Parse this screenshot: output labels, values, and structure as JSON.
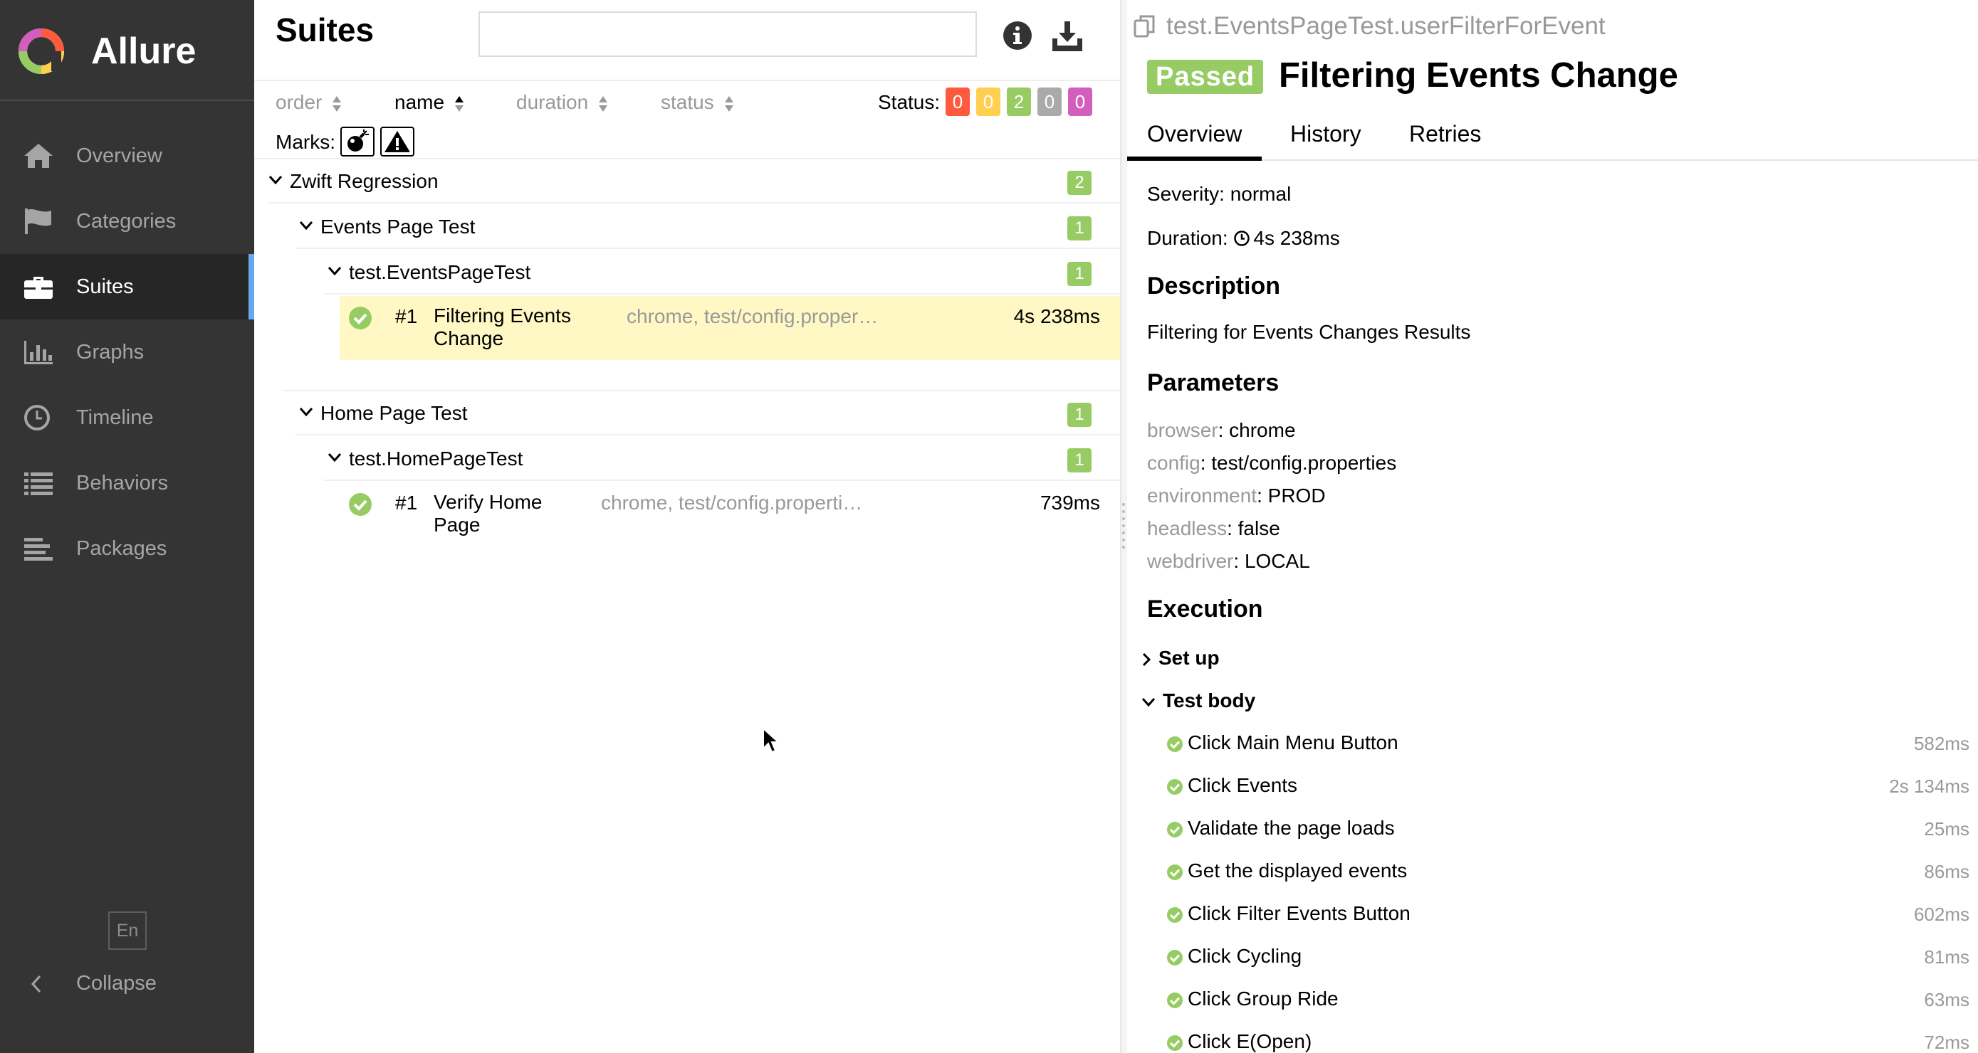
{
  "sidebar": {
    "brand": "Allure",
    "items": [
      {
        "label": "Overview",
        "icon": "home-icon"
      },
      {
        "label": "Categories",
        "icon": "flag-icon"
      },
      {
        "label": "Suites",
        "icon": "briefcase-icon",
        "active": true
      },
      {
        "label": "Graphs",
        "icon": "bar-chart-icon"
      },
      {
        "label": "Timeline",
        "icon": "clock-icon"
      },
      {
        "label": "Behaviors",
        "icon": "list-icon"
      },
      {
        "label": "Packages",
        "icon": "align-left-icon"
      }
    ],
    "language": "En",
    "collapse_label": "Collapse"
  },
  "suites": {
    "title": "Suites",
    "search_value": "",
    "sorters": [
      "order",
      "name",
      "duration",
      "status"
    ],
    "status_label": "Status:",
    "status_counts": [
      {
        "value": "0",
        "color": "#fd5a3e",
        "name": "failed"
      },
      {
        "value": "0",
        "color": "#ffd050",
        "name": "broken"
      },
      {
        "value": "2",
        "color": "#97cc64",
        "name": "passed"
      },
      {
        "value": "0",
        "color": "#aaaaaa",
        "name": "skipped"
      },
      {
        "value": "0",
        "color": "#d35ebe",
        "name": "unknown"
      }
    ],
    "marks_label": "Marks:",
    "tree": {
      "root": {
        "label": "Zwift Regression",
        "count": "2"
      },
      "events_suite": {
        "label": "Events Page Test",
        "count": "1"
      },
      "events_class": {
        "label": "test.EventsPageTest",
        "count": "1"
      },
      "events_test": {
        "num": "#1",
        "name": "Filtering Events Change",
        "params": "chrome, test/config.properties, PROD, false, LOCAL",
        "duration": "4s 238ms"
      },
      "home_suite": {
        "label": "Home Page Test",
        "count": "1"
      },
      "home_class": {
        "label": "test.HomePageTest",
        "count": "1"
      },
      "home_test": {
        "num": "#1",
        "name": "Verify Home Page",
        "params": "chrome, test/config.properties, PROD, false, LOCAL",
        "duration": "739ms"
      }
    }
  },
  "detail": {
    "path": "test.EventsPageTest.userFilterForEvent",
    "status_badge": "Passed",
    "title": "Filtering Events Change",
    "tabs": [
      "Overview",
      "History",
      "Retries"
    ],
    "severity": "Severity: normal",
    "duration_label": "Duration:",
    "duration_value": "4s 238ms",
    "description_heading": "Description",
    "description_text": "Filtering for Events Changes Results",
    "parameters_heading": "Parameters",
    "parameters": [
      {
        "key": "browser",
        "value": ": chrome"
      },
      {
        "key": "config",
        "value": ": test/config.properties"
      },
      {
        "key": "environment",
        "value": ": PROD"
      },
      {
        "key": "headless",
        "value": ": false"
      },
      {
        "key": "webdriver",
        "value": ": LOCAL"
      }
    ],
    "execution_heading": "Execution",
    "setup_label": "Set up",
    "testbody_label": "Test body",
    "steps": [
      {
        "name": "Click Main Menu Button",
        "duration": "582ms"
      },
      {
        "name": "Click Events",
        "duration": "2s 134ms"
      },
      {
        "name": "Validate the page loads",
        "duration": "25ms"
      },
      {
        "name": "Get the displayed events",
        "duration": "86ms"
      },
      {
        "name": "Click Filter Events Button",
        "duration": "602ms"
      },
      {
        "name": "Click Cycling",
        "duration": "81ms"
      },
      {
        "name": "Click Group Ride",
        "duration": "63ms"
      },
      {
        "name": "Click E(Open)",
        "duration": "72ms"
      }
    ]
  }
}
